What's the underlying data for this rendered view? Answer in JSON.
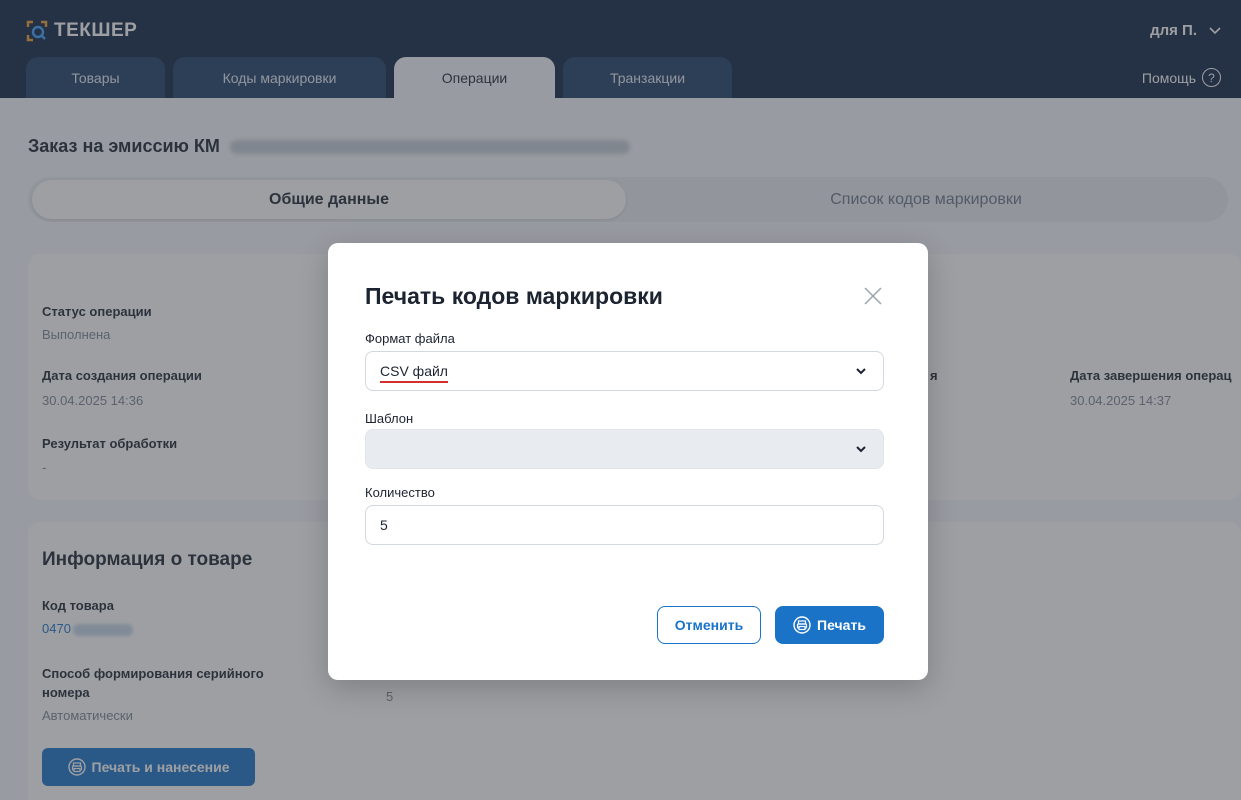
{
  "header": {
    "logo_text": "ТЕКШЕР",
    "user_label": "для П.",
    "help_label": "Помощь",
    "help_icon_text": "?",
    "tabs": [
      {
        "label": "Товары"
      },
      {
        "label": "Коды маркировки"
      },
      {
        "label": "Операции"
      },
      {
        "label": "Транзакции"
      }
    ],
    "active_tab": "Операции"
  },
  "page": {
    "title": "Заказ на эмиссию КМ",
    "segments": {
      "general": "Общие данные",
      "codes_list": "Список кодов маркировки"
    }
  },
  "details": {
    "status_label": "Статус операции",
    "status_value": "Выполнена",
    "created_label": "Дата создания операции",
    "created_value": "30.04.2025 14:36",
    "hidden_label_fragment": "я",
    "completed_label": "Дата завершения операц",
    "completed_value": "30.04.2025 14:37",
    "result_label": "Результат обработки",
    "result_value": "-"
  },
  "product_info": {
    "title": "Информация о товаре",
    "code_label": "Код товара",
    "code_value": "0470",
    "serial_method_label": "Способ формирования серийного номера",
    "serial_method_value": "Автоматически",
    "count_value": "5",
    "print_apply_button": "Печать и нанесение"
  },
  "modal": {
    "title": "Печать кодов маркировки",
    "format_label": "Формат файла",
    "format_value": "CSV файл",
    "template_label": "Шаблон",
    "template_value": "",
    "quantity_label": "Количество",
    "quantity_value": "5",
    "cancel_button": "Отменить",
    "print_button": "Печать"
  },
  "colors": {
    "header_bg": "#0f2340",
    "accent": "#1a73c7",
    "annotation_underline": "#d32f2f"
  }
}
